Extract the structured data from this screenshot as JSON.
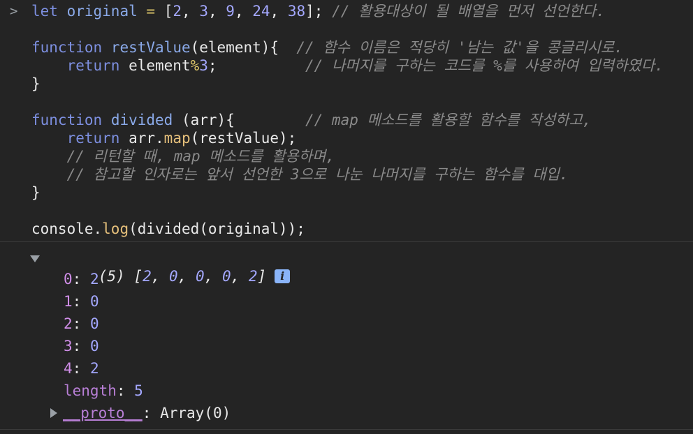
{
  "input": {
    "prompt": ">",
    "line1": {
      "kw": "let",
      "name": "original",
      "eq": "=",
      "open": "[",
      "n1": "2",
      "n2": "3",
      "n3": "9",
      "n4": "24",
      "n5": "38",
      "close": "];",
      "comment": "// 활용대상이 될 배열을 먼저 선언한다."
    },
    "line2": {
      "kw": "function",
      "name": "restValue",
      "params": "(element){",
      "comment": "// 함수 이름은 적당히 '남는 값'을 콩글리시로."
    },
    "line3": {
      "kw": "return",
      "expr": "element",
      "op": "%",
      "num": "3",
      "semi": ";",
      "comment": "// 나머지를 구하는 코드를 %를 사용하여 입력하였다."
    },
    "line4": "}",
    "line5": {
      "kw": "function",
      "name": "divided",
      "params": "(arr){",
      "comment": "// map 메소드를 활용할 함수를 작성하고,"
    },
    "line6": {
      "kw": "return",
      "obj": "arr.",
      "method": "map",
      "args": "(restValue);"
    },
    "line7": "// 리턴할 때, map 메소드를 활용하며,",
    "line8": "// 참고할 인자로는 앞서 선언한 3으로 나눈 나머지를 구하는 함수를 대입.",
    "line9": "}",
    "line10": {
      "obj": "console.",
      "method": "log",
      "args": "(divided(original));"
    }
  },
  "output": {
    "summary_prefix": "(5) [",
    "summary_values": [
      "2",
      "0",
      "0",
      "0",
      "2"
    ],
    "summary_suffix": "]",
    "info_icon": "i",
    "items": [
      {
        "key": "0",
        "value": "2"
      },
      {
        "key": "1",
        "value": "0"
      },
      {
        "key": "2",
        "value": "0"
      },
      {
        "key": "3",
        "value": "0"
      },
      {
        "key": "4",
        "value": "2"
      }
    ],
    "length_key": "length",
    "length_value": "5",
    "proto_key": "__proto__",
    "proto_value": "Array(0)"
  },
  "colors": {
    "background": "#242424",
    "keyword": "#7d8fe0",
    "number": "#a4a8ff",
    "comment": "#8a8a8a",
    "property_key": "#d08ee8",
    "method": "#e6c07b"
  }
}
